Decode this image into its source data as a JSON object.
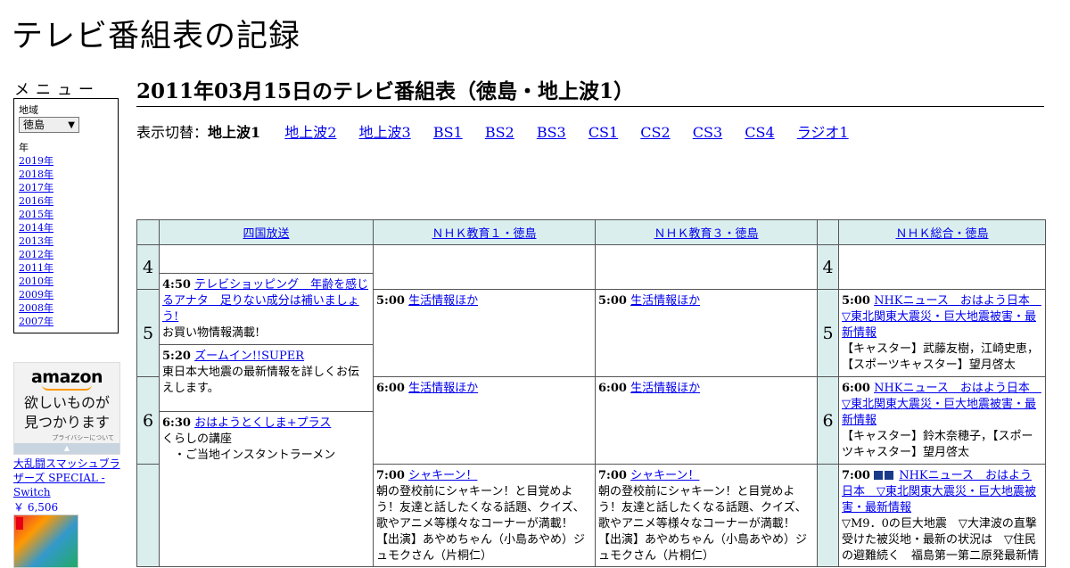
{
  "site": {
    "title": "テレビ番組表の記録"
  },
  "menu": {
    "heading": "メニュー",
    "region_label": "地域",
    "region_selected": "徳島",
    "year_label": "年",
    "years": [
      "2019年",
      "2018年",
      "2017年",
      "2016年",
      "2015年",
      "2014年",
      "2013年",
      "2012年",
      "2011年",
      "2010年",
      "2009年",
      "2008年",
      "2007年"
    ]
  },
  "ad": {
    "brand": "amazon",
    "tagline_1": "欲しいものが",
    "tagline_2": "見つかります",
    "privacy": "プライバシーについて",
    "product_title": "大乱闘スマッシュブラザーズ SPECIAL - Switch",
    "product_price": "￥ 6,506"
  },
  "main": {
    "title": "2011年03月15日のテレビ番組表（徳島・地上波1）",
    "switch_label": "表示切替：",
    "switch_current": "地上波1",
    "switch_links": [
      "地上波2",
      "地上波3",
      "BS1",
      "BS2",
      "BS3",
      "CS1",
      "CS2",
      "CS3",
      "CS4",
      "ラジオ1"
    ]
  },
  "schedule": {
    "channels": [
      "四国放送",
      "ＮＨＫ教育１・徳島",
      "ＮＨＫ教育３・徳島",
      "ＮＨＫ総合・徳島"
    ],
    "hours": [
      "4",
      "5",
      "6"
    ],
    "ch1": [
      {
        "time": "4:50",
        "title": "テレビショッピング　年齢を感じるアナタ　足りない成分は補いましょう!",
        "desc": "お買い物情報満載!"
      },
      {
        "time": "5:20",
        "title": "ズームイン!!SUPER",
        "desc": "東日本大地震の最新情報を詳しくお伝えします。"
      },
      {
        "time": "6:30",
        "title": "おはようとくしま+プラス",
        "desc": "くらしの講座\n　・ご当地インスタントラーメン"
      }
    ],
    "ch2": [
      {
        "time": "5:00",
        "title": "生活情報ほか",
        "desc": ""
      },
      {
        "time": "6:00",
        "title": "生活情報ほか",
        "desc": ""
      },
      {
        "time": "7:00",
        "title": "シャキーン！",
        "desc": "朝の登校前にシャキーン！と目覚めよう！友達と話したくなる話題、クイズ、歌やアニメ等様々なコーナーが満載！【出演】あやめちゃん（小島あやめ）ジュモクさん（片桐仁）"
      }
    ],
    "ch3": [
      {
        "time": "5:00",
        "title": "生活情報ほか",
        "desc": ""
      },
      {
        "time": "6:00",
        "title": "生活情報ほか",
        "desc": ""
      },
      {
        "time": "7:00",
        "title": "シャキーン！",
        "desc": "朝の登校前にシャキーン！と目覚めよう！友達と話したくなる話題、クイズ、歌やアニメ等様々なコーナーが満載！【出演】あやめちゃん（小島あやめ）ジュモクさん（片桐仁）"
      }
    ],
    "ch4": [
      {
        "time": "5:00",
        "title": "NHKニュース　おはよう日本　▽東北関東大震災・巨大地震被害・最新情報",
        "desc": "【キャスター】武藤友樹，江崎史恵，【スポーツキャスター】望月啓太"
      },
      {
        "time": "6:00",
        "title": "NHKニュース　おはよう日本　▽東北関東大震災・巨大地震被害・最新情報",
        "desc": "【キャスター】鈴木奈穂子，【スポーツキャスター】望月啓太"
      },
      {
        "time": "7:00",
        "title": "NHKニュース　おはよう日本　▽東北関東大震災・巨大地震被害・最新情報",
        "desc": "▽M9．0の巨大地震　▽大津波の直撃受けた被災地・最新の状況は　▽住民の避難続く　福島第一第二原発最新情"
      }
    ]
  }
}
